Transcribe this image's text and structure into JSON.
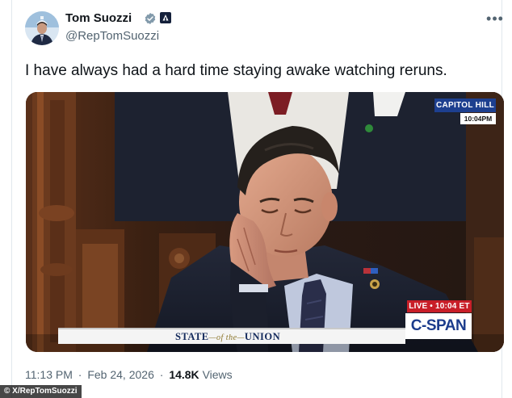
{
  "user": {
    "display_name": "Tom Suozzi",
    "handle": "@RepTomSuozzi",
    "verified_icon": "verified-badge-icon",
    "affiliation_icon": "government-badge-icon"
  },
  "tweet": {
    "text": "I have always had a hard time staying awake watching reruns."
  },
  "media": {
    "capitol_hill_label": "CAPITOL HILL",
    "capitol_time": "10:04PM",
    "sotu_state": "STATE",
    "sotu_of": "—of the—",
    "sotu_union": "UNION",
    "live_label": "LIVE • 10:04 ET",
    "network": "C-SPAN"
  },
  "meta": {
    "time": "11:13 PM",
    "separator": "·",
    "date": "Feb 24, 2026",
    "views_count": "14.8K",
    "views_label": "Views"
  },
  "credit": "© X/RepTomSuozzi",
  "colors": {
    "text_primary": "#0f1419",
    "text_secondary": "#536471",
    "verified_badge": "#829aab",
    "cspan_blue": "#1c3c8c",
    "live_red": "#c81e28"
  }
}
